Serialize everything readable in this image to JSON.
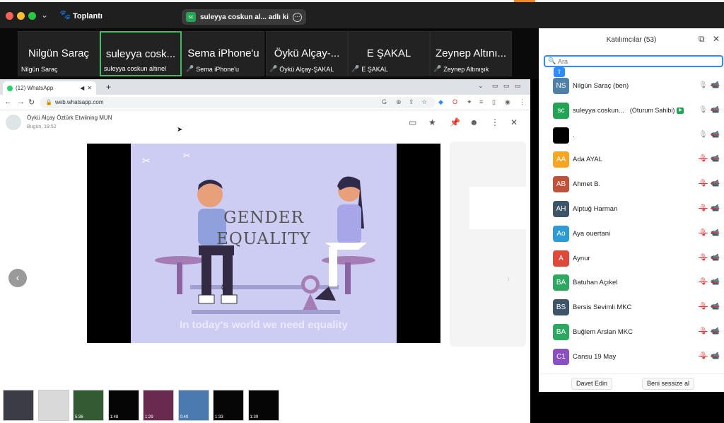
{
  "window": {
    "title": "Toplantı",
    "share_indicator": {
      "avatar": "sc",
      "text": "suleyya coskun al... adlı kişinin"
    }
  },
  "video_strip": [
    {
      "display": "Nilgün Saraç",
      "label": "Nilgün Saraç",
      "muted": false,
      "active": false
    },
    {
      "display": "suleyya cosk...",
      "label": "suleyya coskun altınel",
      "muted": false,
      "active": true
    },
    {
      "display": "Sema iPhone'u",
      "label": "Sema iPhone'u",
      "muted": true,
      "active": false
    },
    {
      "display": "Öykü Alçay-...",
      "label": "Öykü Alçay-ŞAKAL",
      "muted": true,
      "active": false
    },
    {
      "display": "E ŞAKAL",
      "label": "E ŞAKAL",
      "muted": true,
      "active": false
    },
    {
      "display": "Zeynep Altını...",
      "label": "Zeynep Altınışık",
      "muted": true,
      "active": false
    }
  ],
  "browser": {
    "tab_label": "(12) WhatsApp",
    "url": "web.whatsapp.com"
  },
  "whatsapp": {
    "sender": "Öykü Alçay Öztürk Etwiining MUN",
    "time": "Bugün, 19:52",
    "video": {
      "title_line1": "GENDER",
      "title_line2": "EQUALITY",
      "subtitle": "In today's world we need equality"
    },
    "thumbnails": [
      {
        "duration": "",
        "color": "#3c3c44"
      },
      {
        "duration": "",
        "color": "#d9d9d9"
      },
      {
        "duration": "5:36",
        "color": "#335a33"
      },
      {
        "duration": "1:48",
        "color": "#050505"
      },
      {
        "duration": "1:29",
        "color": "#6a2a50"
      },
      {
        "duration": "0:40",
        "color": "#4a7ab0"
      },
      {
        "duration": "1:33",
        "color": "#060606"
      },
      {
        "duration": "1:39",
        "color": "#050505"
      }
    ]
  },
  "participants_panel": {
    "title": "Katılımcılar (53)",
    "search_placeholder": "Ara",
    "host_label": "(Oturum Sahibi)",
    "participants": [
      {
        "initials": "NS",
        "name": "Nilgün Saraç (ben)",
        "color": "#4f81a8",
        "mic_muted": false,
        "host": false
      },
      {
        "initials": "sc",
        "name": "suleyya coskun...",
        "color": "#23a455",
        "mic_muted": false,
        "host": true
      },
      {
        "initials": "",
        "name": ".",
        "color": "#000000",
        "mic_muted": false,
        "host": false
      },
      {
        "initials": "AA",
        "name": "Ada AYAL",
        "color": "#f5a623",
        "mic_muted": true,
        "host": false
      },
      {
        "initials": "AB",
        "name": "Ahmet B.",
        "color": "#c0523a",
        "mic_muted": true,
        "host": false
      },
      {
        "initials": "AH",
        "name": "Alptuğ Harman",
        "color": "#3e5468",
        "mic_muted": true,
        "host": false
      },
      {
        "initials": "Ao",
        "name": "Aya ouertani",
        "color": "#2e9bd6",
        "mic_muted": true,
        "host": false
      },
      {
        "initials": "A",
        "name": "Aynur",
        "color": "#e0483a",
        "mic_muted": true,
        "host": false
      },
      {
        "initials": "BA",
        "name": "Batuhan Açıkel",
        "color": "#2da860",
        "mic_muted": true,
        "host": false
      },
      {
        "initials": "BS",
        "name": "Bersis Sevimli MKC",
        "color": "#3e5468",
        "mic_muted": true,
        "host": false
      },
      {
        "initials": "BA",
        "name": "Buğlem Arslan MKC",
        "color": "#2da860",
        "mic_muted": true,
        "host": false
      },
      {
        "initials": "C1",
        "name": "Cansu 19 May",
        "color": "#8a4fc0",
        "mic_muted": true,
        "host": false
      }
    ],
    "invite_label": "Davet Edin",
    "mute_me_label": "Beni sessize al"
  }
}
